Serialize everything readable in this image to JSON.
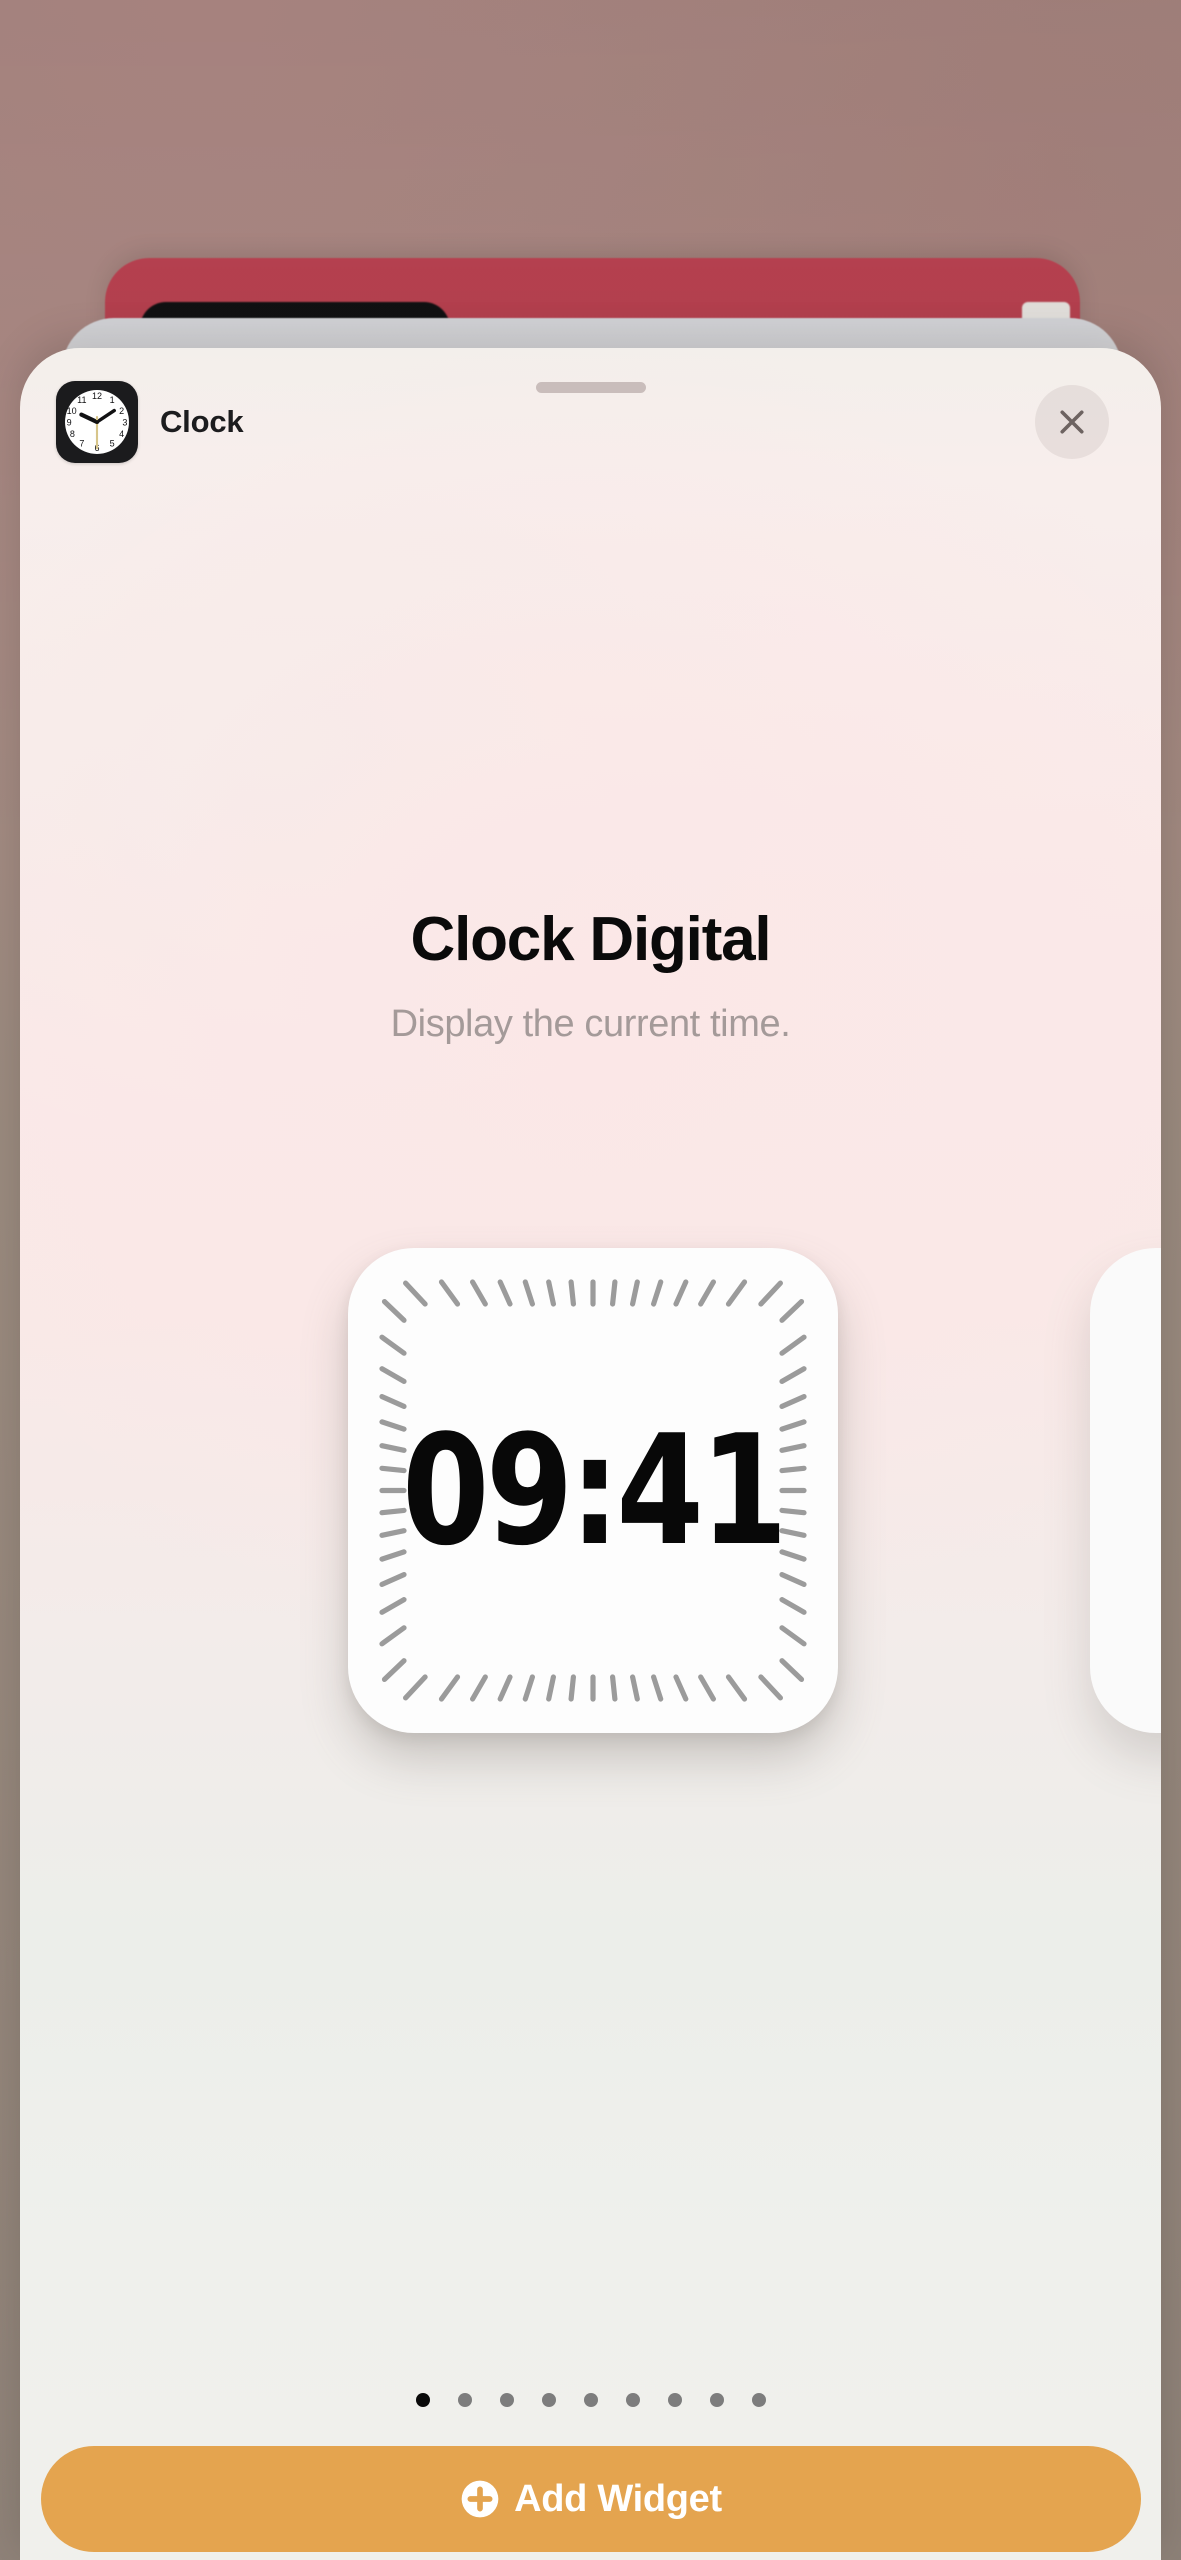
{
  "background": {
    "kind": "blurred-home-screen",
    "accent_card_color": "#bd4352"
  },
  "sheet": {
    "grabber": "drag-handle",
    "app": {
      "icon": "clock-icon",
      "name": "Clock"
    },
    "close_label": "✕",
    "title": "Clock Digital",
    "subtitle": "Display the current time.",
    "preview": {
      "widget_kind": "digital-clock",
      "time": "09:41",
      "tick_count": 60,
      "tick_color": "#8a8a8a",
      "card_color": "#fdfdfd"
    },
    "pagination": {
      "total": 9,
      "active_index": 0,
      "active_color": "#0a0a0a",
      "inactive_color": "#7d7d7d"
    },
    "add_button": {
      "label": "Add Widget",
      "icon": "plus-circle-icon",
      "color": "#e4a44f",
      "text_color": "#ffffff"
    }
  }
}
